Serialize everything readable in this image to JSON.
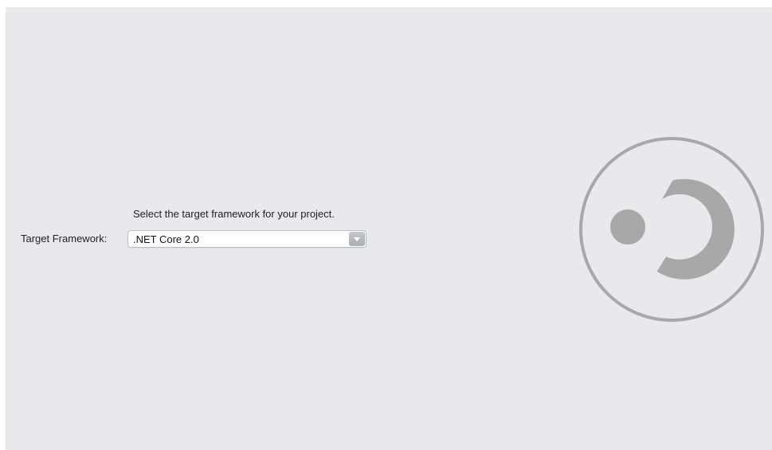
{
  "wizard": {
    "instruction": "Select the target framework for your project.",
    "framework_label": "Target Framework:",
    "framework_value": ".NET Core 2.0"
  },
  "colors": {
    "panel_background": "#e7e9ed",
    "logo_gray": "#a8a8a8"
  },
  "icons": {
    "dropdown": "chevron-down-icon",
    "logo": "visual-studio-logo-icon"
  }
}
